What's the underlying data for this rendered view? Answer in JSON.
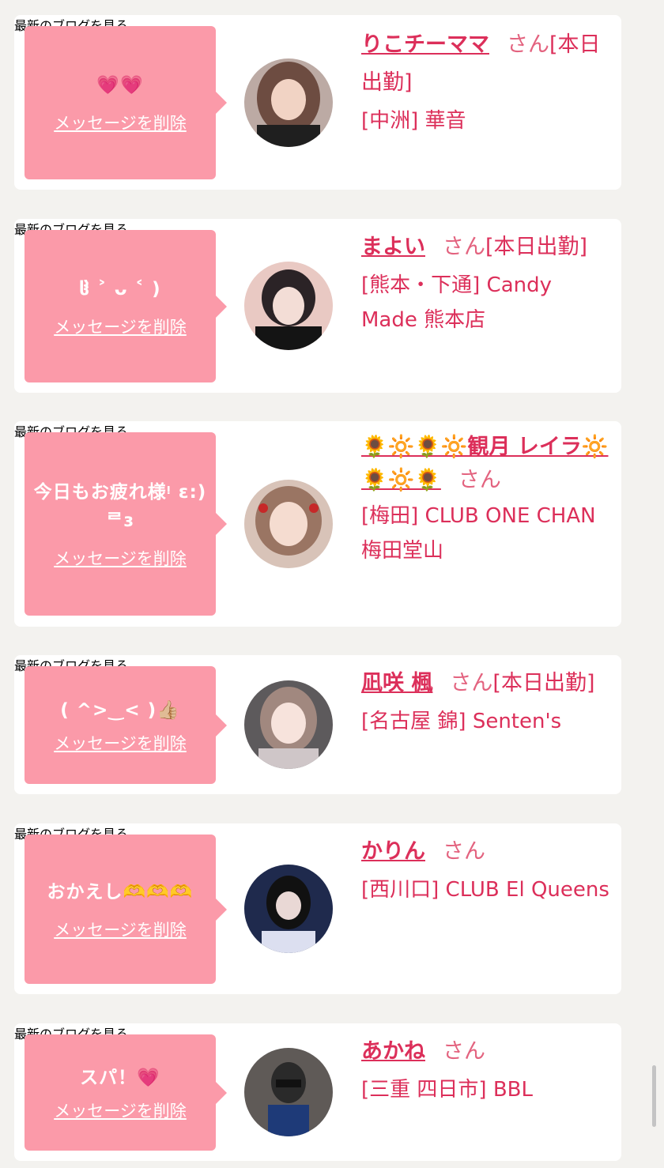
{
  "common": {
    "delete_label": "メッセージを削除",
    "blog_label": "最新のブログを見る",
    "honorific": "さん"
  },
  "colors": {
    "page_background": "#f3f2ef",
    "card_background": "#ffffff",
    "bubble_pink": "#fb9aa9",
    "name_red": "#dc2f5a",
    "link_gray": "#8f8f8f"
  },
  "messages": [
    {
      "message": "💗💗",
      "name": "りこチーママ",
      "status": "[本日出勤]",
      "shop": "[中洲] 華音"
    },
    {
      "message": "ჱ̒ ˃ ᴗ ˂ )",
      "name": "まよい",
      "status": "[本日出勤]",
      "shop": "[熊本・下通] Candy Made 熊本店"
    },
    {
      "message": "今日もお疲れ様ᵎ ɛ:) ᄅɜ",
      "name": "🌻🔆🌻🔆観月 レイラ🔆🌻🔆🌻",
      "status": "",
      "shop": "[梅田] CLUB ONE CHAN 梅田堂山"
    },
    {
      "message": "( ^>‿< )👍🏼",
      "name": "凪咲 楓",
      "status": "[本日出勤]",
      "shop": "[名古屋 錦] Senten's"
    },
    {
      "message": "おかえし🫶🫶🫶",
      "name": "かりん",
      "status": "",
      "shop": "[西川口] CLUB El Queens"
    },
    {
      "message": "スパ！💗",
      "name": "あかね",
      "status": "",
      "shop": "[三重 四日市] BBL"
    }
  ]
}
